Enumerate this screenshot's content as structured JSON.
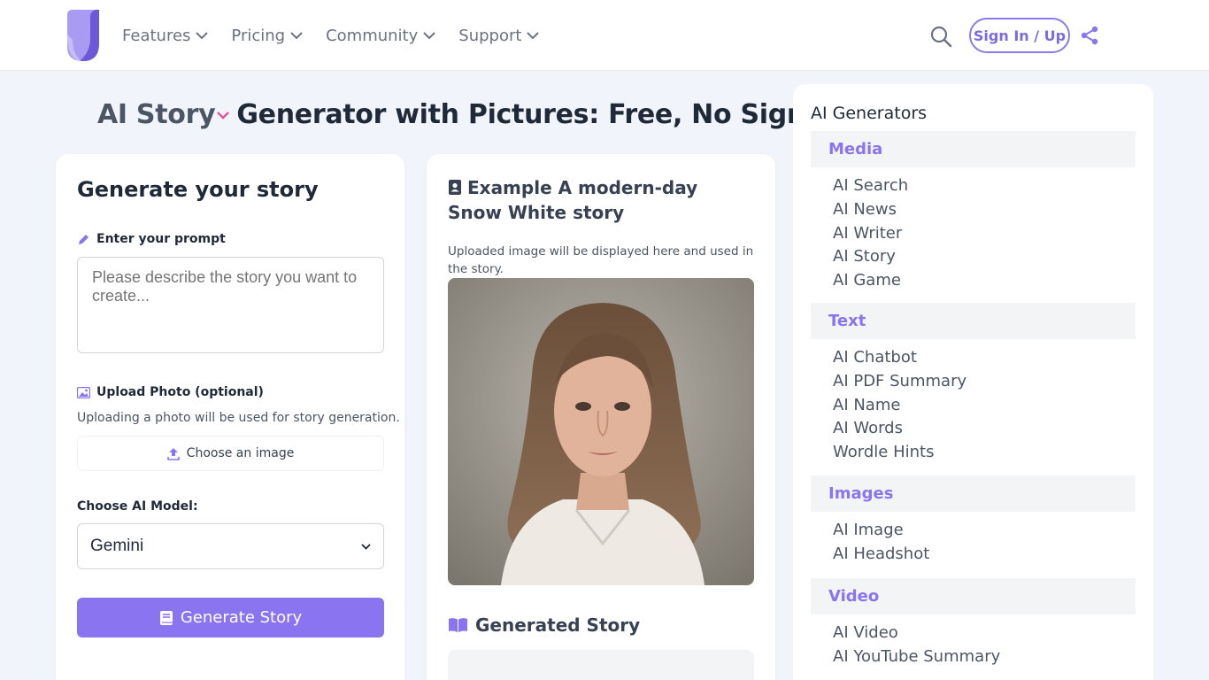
{
  "header": {
    "nav": [
      {
        "label": "Features"
      },
      {
        "label": "Pricing"
      },
      {
        "label": "Community"
      },
      {
        "label": "Support"
      }
    ],
    "signin_label": "Sign In / Up",
    "accent_color": "#8b74ef"
  },
  "page": {
    "title_switch": "AI Story",
    "title_rest": "Generator with Pictures: Free, No Signup"
  },
  "generator": {
    "heading": "Generate your story",
    "prompt_label": "Enter your prompt",
    "prompt_placeholder": "Please describe the story you want to create...",
    "upload_label": "Upload Photo (optional)",
    "upload_help": "Uploading a photo will be used for story generation.",
    "choose_image": "Choose an image",
    "model_label": "Choose AI Model:",
    "model_value": "Gemini",
    "generate_label": "Generate Story"
  },
  "example": {
    "title": "Example A modern-day Snow White story",
    "note": "Uploaded image will be displayed here and used in the story.",
    "generated_heading": "Generated Story"
  },
  "sidebar": {
    "title": "AI Generators",
    "sections": [
      {
        "name": "Media",
        "items": [
          "AI Search",
          "AI News",
          "AI Writer",
          "AI Story",
          "AI Game"
        ]
      },
      {
        "name": "Text",
        "items": [
          "AI Chatbot",
          "AI PDF Summary",
          "AI Name",
          "AI Words",
          "Wordle Hints"
        ]
      },
      {
        "name": "Images",
        "items": [
          "AI Image",
          "AI Headshot"
        ]
      },
      {
        "name": "Video",
        "items": [
          "AI Video",
          "AI YouTube Summary"
        ]
      }
    ]
  }
}
